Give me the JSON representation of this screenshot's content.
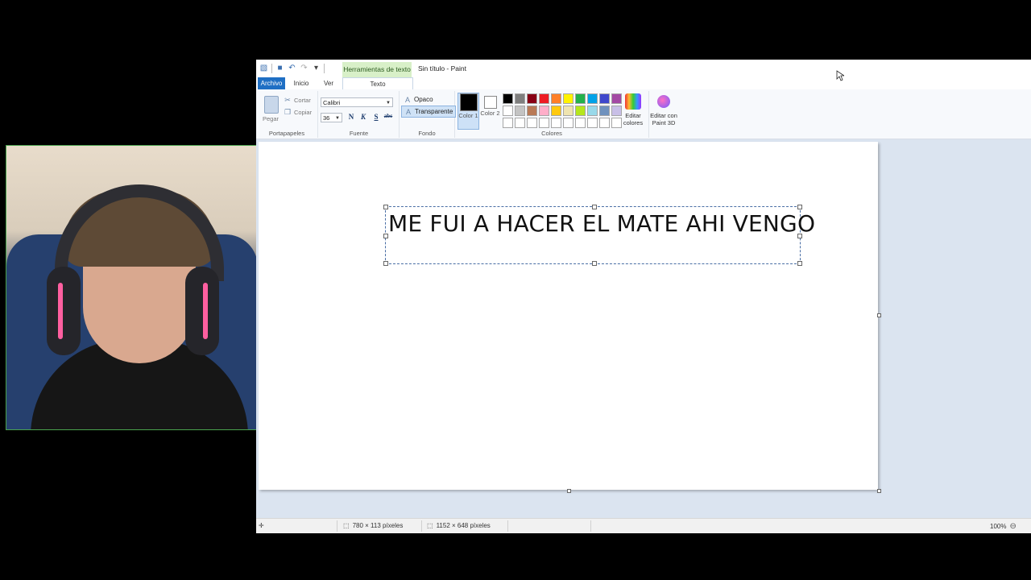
{
  "window": {
    "title": "Sin título - Paint",
    "context_tab": "Herramientas de texto"
  },
  "tabs": {
    "file": "Archivo",
    "home": "Inicio",
    "view": "Ver",
    "text": "Texto"
  },
  "clipboard": {
    "paste": "Pegar",
    "cut": "Cortar",
    "copy": "Copiar",
    "group_label": "Portapapeles"
  },
  "font": {
    "family": "Calibri",
    "size": "36",
    "bold": "N",
    "italic": "K",
    "underline": "S",
    "strike": "abc",
    "group_label": "Fuente"
  },
  "background": {
    "opaque": "Opaco",
    "transparent": "Transparente",
    "group_label": "Fondo"
  },
  "colors": {
    "color1_label": "Color 1",
    "color1_value": "#000000",
    "color2_label": "Color 2",
    "color2_value": "#ffffff",
    "edit_colors": "Editar colores",
    "edit_paint3d": "Editar con Paint 3D",
    "group_label": "Colores",
    "palette": [
      "#000000",
      "#7f7f7f",
      "#880015",
      "#ed1c24",
      "#ff7f27",
      "#fff200",
      "#22b14c",
      "#00a2e8",
      "#3f48cc",
      "#a349a4",
      "#ffffff",
      "#c3c3c3",
      "#b97a57",
      "#ffaec9",
      "#ffc90e",
      "#efe4b0",
      "#b5e61d",
      "#99d9ea",
      "#7092be",
      "#c8bfe7",
      "#ffffff",
      "#ffffff",
      "#ffffff",
      "#ffffff",
      "#ffffff",
      "#ffffff",
      "#ffffff",
      "#ffffff",
      "#ffffff",
      "#ffffff"
    ]
  },
  "canvas": {
    "text": "ME FUI A  HACER EL MATE AHI VENGO"
  },
  "status": {
    "selection_size": "780 × 113 píxeles",
    "image_size": "1152 × 648 píxeles",
    "zoom": "100%"
  }
}
